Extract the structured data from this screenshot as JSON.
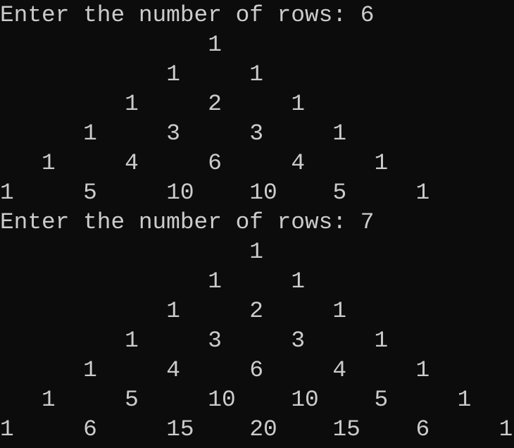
{
  "console": {
    "background": "#0c0c0c",
    "foreground": "#cccccc",
    "runs": [
      {
        "prompt": "Enter the number of rows: ",
        "input": "6",
        "rows": [
          [
            1
          ],
          [
            1,
            1
          ],
          [
            1,
            2,
            1
          ],
          [
            1,
            3,
            3,
            1
          ],
          [
            1,
            4,
            6,
            4,
            1
          ],
          [
            1,
            5,
            10,
            10,
            5,
            1
          ]
        ]
      },
      {
        "prompt": "Enter the number of rows: ",
        "input": "7",
        "rows": [
          [
            1
          ],
          [
            1,
            1
          ],
          [
            1,
            2,
            1
          ],
          [
            1,
            3,
            3,
            1
          ],
          [
            1,
            4,
            6,
            4,
            1
          ],
          [
            1,
            5,
            10,
            10,
            5,
            1
          ],
          [
            1,
            6,
            15,
            20,
            15,
            6,
            1
          ]
        ]
      }
    ]
  }
}
